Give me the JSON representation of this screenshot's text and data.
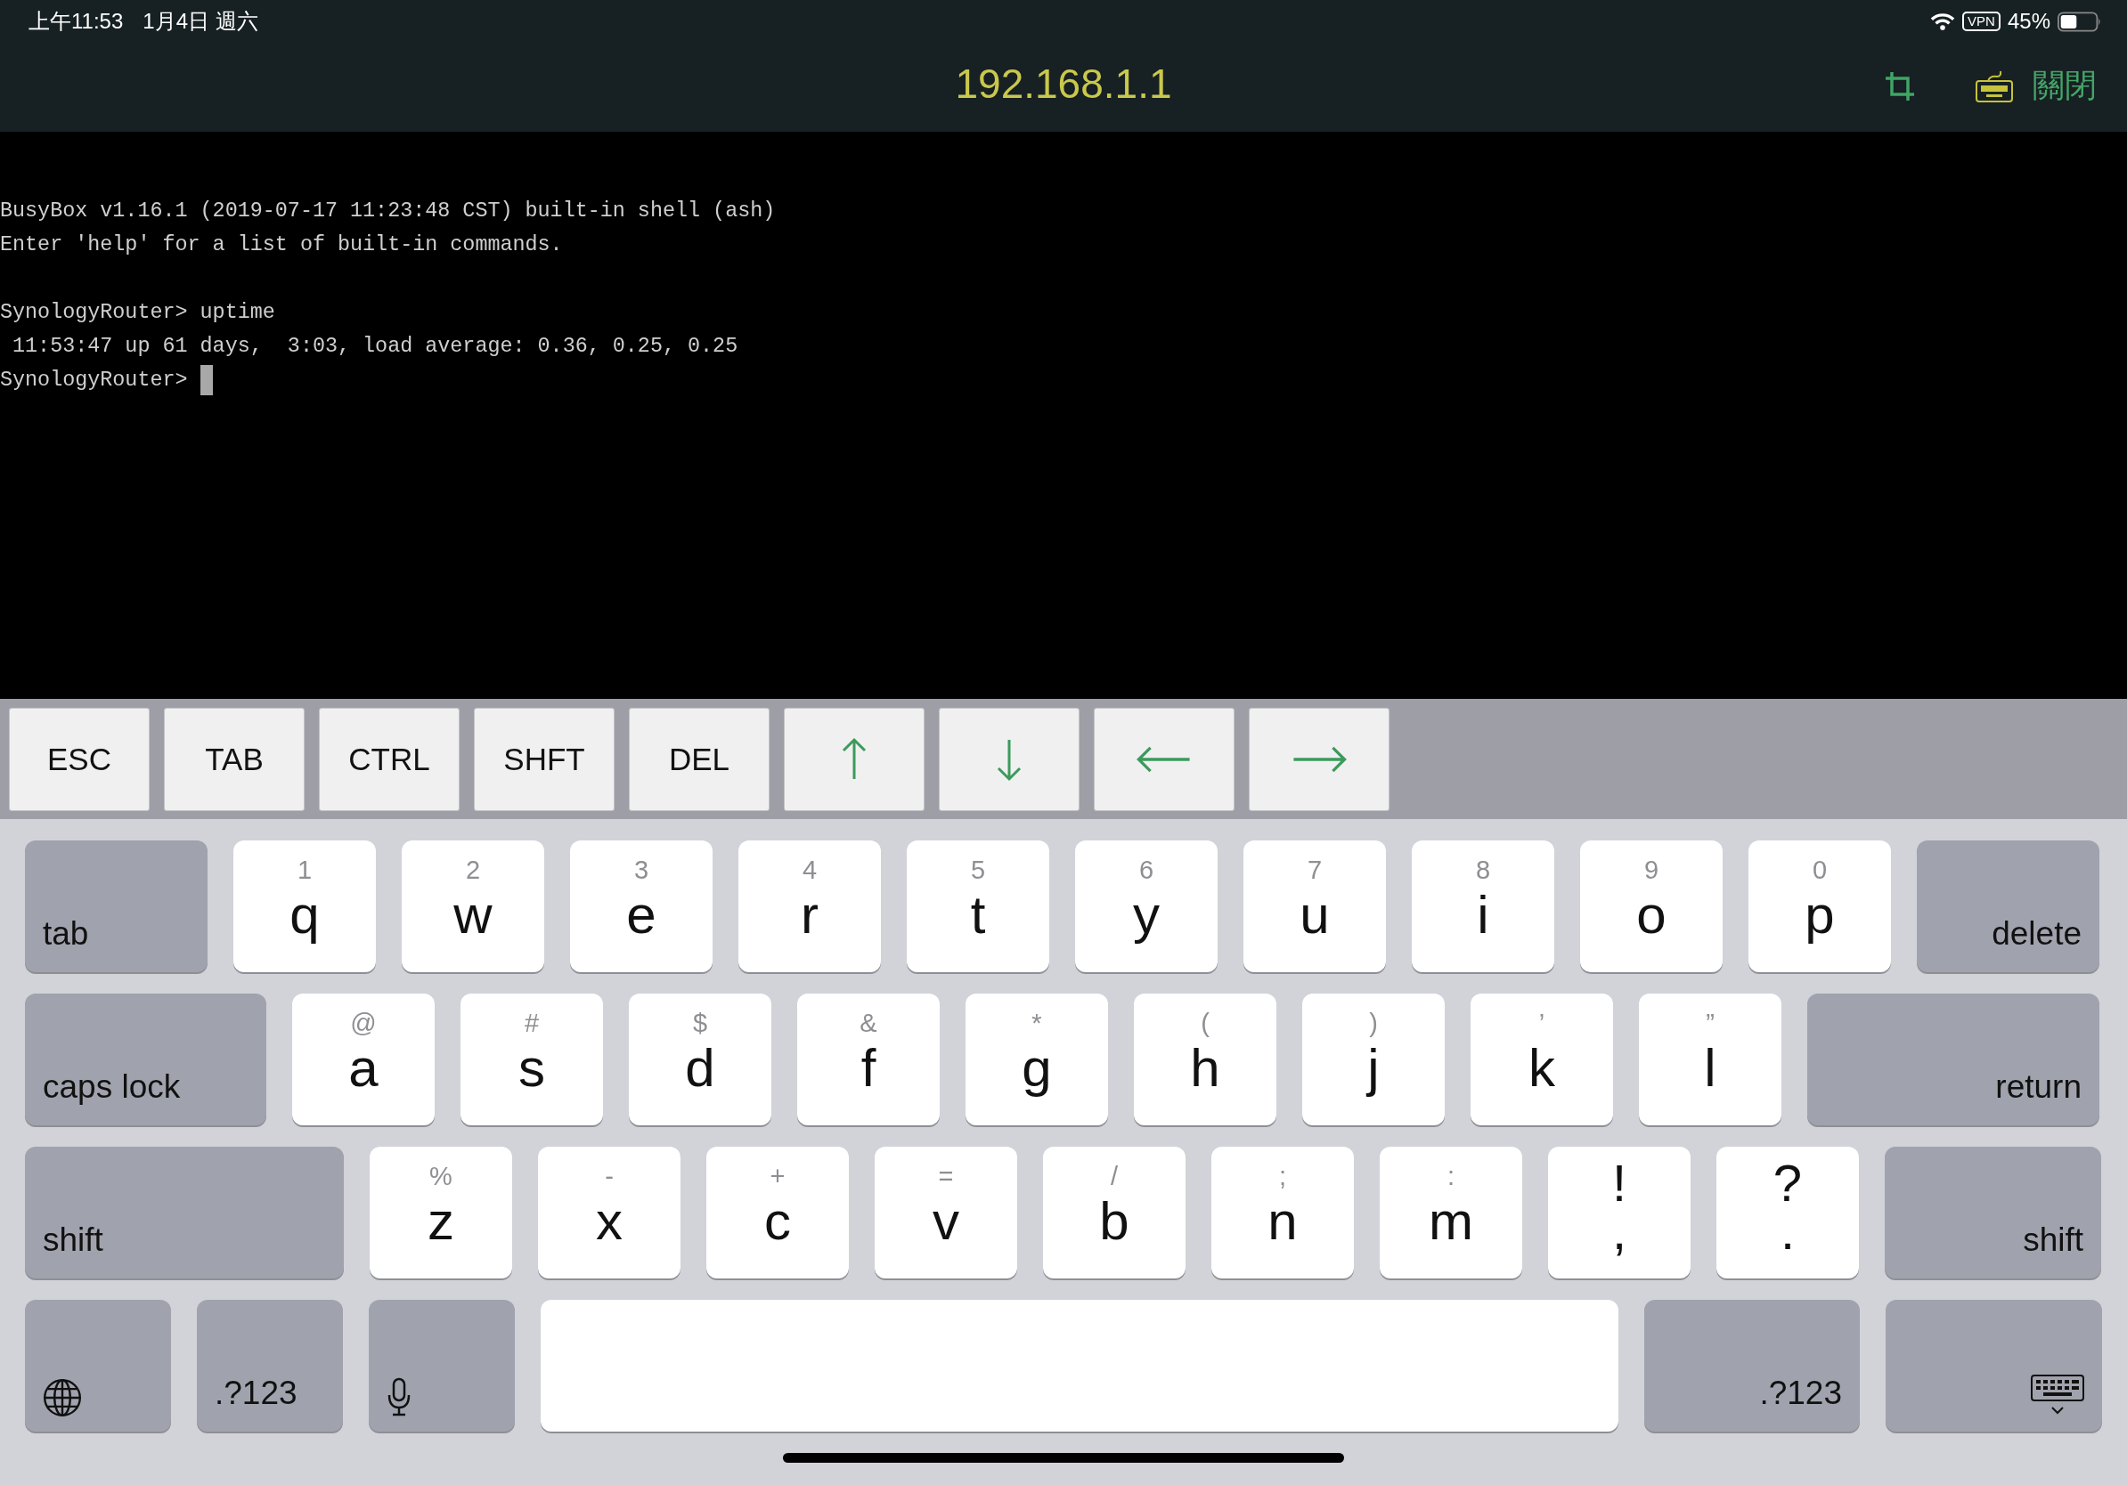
{
  "status_bar": {
    "time": "上午11:53",
    "date": "1月4日 週六",
    "vpn": "VPN",
    "battery": "45%"
  },
  "header": {
    "title": "192.168.1.1",
    "close": "關閉"
  },
  "terminal": {
    "blocks": [
      [
        "BusyBox v1.16.1 (2019-07-17 11:23:48 CST) built-in shell (ash)",
        "Enter 'help' for a list of built-in commands."
      ],
      [
        "SynologyRouter> uptime",
        " 11:53:47 up 61 days,  3:03, load average: 0.36, 0.25, 0.25",
        "SynologyRouter> "
      ]
    ]
  },
  "accessory_keys": [
    {
      "kind": "text",
      "label": "ESC"
    },
    {
      "kind": "text",
      "label": "TAB"
    },
    {
      "kind": "text",
      "label": "CTRL"
    },
    {
      "kind": "text",
      "label": "SHFT"
    },
    {
      "kind": "text",
      "label": "DEL"
    },
    {
      "kind": "up"
    },
    {
      "kind": "down"
    },
    {
      "kind": "left"
    },
    {
      "kind": "right"
    }
  ],
  "keyboard": {
    "rows": [
      [
        {
          "kind": "function",
          "label": "tab"
        },
        {
          "kind": "letter",
          "hint": "1",
          "label": "q"
        },
        {
          "kind": "letter",
          "hint": "2",
          "label": "w"
        },
        {
          "kind": "letter",
          "hint": "3",
          "label": "e"
        },
        {
          "kind": "letter",
          "hint": "4",
          "label": "r"
        },
        {
          "kind": "letter",
          "hint": "5",
          "label": "t"
        },
        {
          "kind": "letter",
          "hint": "6",
          "label": "y"
        },
        {
          "kind": "letter",
          "hint": "7",
          "label": "u"
        },
        {
          "kind": "letter",
          "hint": "8",
          "label": "i"
        },
        {
          "kind": "letter",
          "hint": "9",
          "label": "o"
        },
        {
          "kind": "letter",
          "hint": "0",
          "label": "p"
        },
        {
          "kind": "function",
          "label": "delete"
        }
      ],
      [
        {
          "kind": "function",
          "label": "caps lock"
        },
        {
          "kind": "letter",
          "hint": "@",
          "label": "a"
        },
        {
          "kind": "letter",
          "hint": "#",
          "label": "s"
        },
        {
          "kind": "letter",
          "hint": "$",
          "label": "d"
        },
        {
          "kind": "letter",
          "hint": "&",
          "label": "f"
        },
        {
          "kind": "letter",
          "hint": "*",
          "label": "g"
        },
        {
          "kind": "letter",
          "hint": "(",
          "label": "h"
        },
        {
          "kind": "letter",
          "hint": ")",
          "label": "j"
        },
        {
          "kind": "letter",
          "hint": "’",
          "label": "k"
        },
        {
          "kind": "letter",
          "hint": "”",
          "label": "l"
        },
        {
          "kind": "function",
          "label": "return"
        }
      ],
      [
        {
          "kind": "function",
          "label": "shift"
        },
        {
          "kind": "letter",
          "hint": "%",
          "label": "z"
        },
        {
          "kind": "letter",
          "hint": "-",
          "label": "x"
        },
        {
          "kind": "letter",
          "hint": "+",
          "label": "c"
        },
        {
          "kind": "letter",
          "hint": "=",
          "label": "v"
        },
        {
          "kind": "letter",
          "hint": "/",
          "label": "b"
        },
        {
          "kind": "letter",
          "hint": ";",
          "label": "n"
        },
        {
          "kind": "letter",
          "hint": ":",
          "label": "m"
        },
        {
          "kind": "symbol",
          "hint": "!",
          "label": ","
        },
        {
          "kind": "symbol",
          "hint": "?",
          "label": "."
        },
        {
          "kind": "function",
          "label": "shift"
        }
      ],
      [
        {
          "kind": "globe"
        },
        {
          "kind": "function",
          "label": ".?123"
        },
        {
          "kind": "mic"
        },
        {
          "kind": "space"
        },
        {
          "kind": "function",
          "label": ".?123"
        },
        {
          "kind": "keyboard"
        }
      ]
    ]
  }
}
